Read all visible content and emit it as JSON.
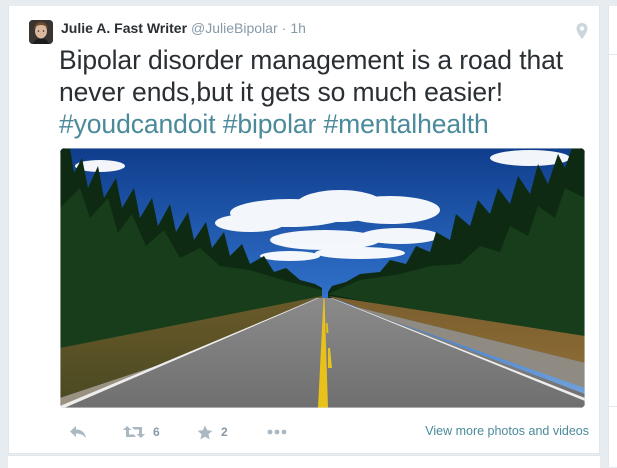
{
  "tweet": {
    "author": {
      "full_name": "Julie A. Fast Writer",
      "handle": "@JulieBipolar",
      "avatar_icon": "user-avatar-photo"
    },
    "separator": "·",
    "timestamp": "1h",
    "text_lines": [
      "Bipolar disorder management is a road that",
      "never ends,but it gets so much easier!"
    ],
    "hashtags": [
      "#youdcandoit",
      "#bipolar",
      "#mentalhealth"
    ],
    "media": {
      "kind": "photo",
      "subject": "road-through-forest"
    },
    "actions": {
      "reply_icon": "reply-icon",
      "retweet_icon": "retweet-icon",
      "retweet_count": "6",
      "favorite_icon": "star-icon",
      "favorite_count": "2",
      "more_icon": "more-icon"
    },
    "view_more_label": "View more photos and videos",
    "location_icon": "location-pin-icon"
  },
  "colors": {
    "background": "#e6ecf0",
    "card": "#ffffff",
    "name": "#292f33",
    "muted": "#8899a6",
    "link": "#4a8a9a"
  }
}
